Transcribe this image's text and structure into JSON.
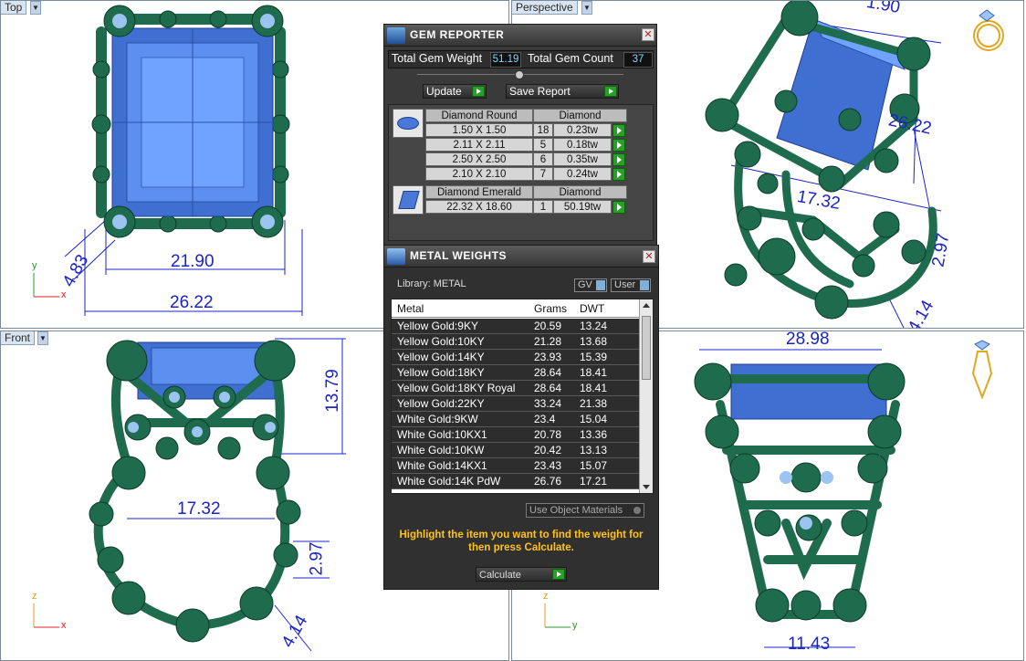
{
  "viewports": {
    "top": {
      "label": "Top"
    },
    "perspective": {
      "label": "Perspective"
    },
    "front": {
      "label": "Front"
    },
    "right": {
      "label": ""
    }
  },
  "dimensions": {
    "top": {
      "width": "21.90",
      "outer": "26.22",
      "side": "4.83"
    },
    "front": {
      "height": "13.79",
      "inner": "17.32",
      "small": "2.97",
      "band": "4.14"
    },
    "perspective": {
      "a": "1.90",
      "b": "26.22",
      "c": "17.32",
      "d": "2.97",
      "e": "4.14"
    },
    "right": {
      "width": "28.98",
      "bottom": "11.43"
    }
  },
  "axes": {
    "top": [
      "y",
      "x"
    ],
    "front": [
      "z",
      "x"
    ],
    "right": [
      "z",
      "y"
    ]
  },
  "gem_reporter": {
    "title": "GEM REPORTER",
    "total_weight_label": "Total Gem Weight",
    "total_weight_value": "51.19",
    "total_count_label": "Total Gem Count",
    "total_count_value": "37",
    "update_label": "Update",
    "save_label": "Save Report",
    "groups": [
      {
        "icon": "round-diamond-icon",
        "header": [
          "Diamond Round",
          "Diamond"
        ],
        "rows": [
          {
            "size": "1.50 X 1.50",
            "count": "18",
            "weight": "0.23tw"
          },
          {
            "size": "2.11 X 2.11",
            "count": "5",
            "weight": "0.18tw"
          },
          {
            "size": "2.50 X 2.50",
            "count": "6",
            "weight": "0.35tw"
          },
          {
            "size": "2.10 X 2.10",
            "count": "7",
            "weight": "0.24tw"
          }
        ]
      },
      {
        "icon": "emerald-diamond-icon",
        "header": [
          "Diamond Emerald",
          "Diamond"
        ],
        "rows": [
          {
            "size": "22.32 X 18.60",
            "count": "1",
            "weight": "50.19tw"
          }
        ]
      }
    ]
  },
  "metal_weights": {
    "title": "METAL WEIGHTS",
    "library_label": "Library: METAL",
    "gv_label": "GV",
    "user_label": "User",
    "columns": [
      "Metal",
      "Grams",
      "DWT"
    ],
    "rows": [
      {
        "metal": "Yellow Gold:9KY",
        "grams": "20.59",
        "dwt": "13.24"
      },
      {
        "metal": "Yellow Gold:10KY",
        "grams": "21.28",
        "dwt": "13.68"
      },
      {
        "metal": "Yellow Gold:14KY",
        "grams": "23.93",
        "dwt": "15.39"
      },
      {
        "metal": "Yellow Gold:18KY",
        "grams": "28.64",
        "dwt": "18.41"
      },
      {
        "metal": "Yellow Gold:18KY Royal",
        "grams": "28.64",
        "dwt": "18.41"
      },
      {
        "metal": "Yellow Gold:22KY",
        "grams": "33.24",
        "dwt": "21.38"
      },
      {
        "metal": "White Gold:9KW",
        "grams": "23.4",
        "dwt": "15.04"
      },
      {
        "metal": "White Gold:10KX1",
        "grams": "20.78",
        "dwt": "13.36"
      },
      {
        "metal": "White Gold:10KW",
        "grams": "20.42",
        "dwt": "13.13"
      },
      {
        "metal": "White Gold:14KX1",
        "grams": "23.43",
        "dwt": "15.07"
      },
      {
        "metal": "White Gold:14K PdW",
        "grams": "26.76",
        "dwt": "17.21"
      }
    ],
    "use_object_materials": "Use Object Materials",
    "hint": "Highlight the item you want to find the weight for then press Calculate.",
    "calculate_label": "Calculate"
  },
  "colors": {
    "gem": "#4a78d8",
    "metal": "#1f6b4e",
    "dimension": "#1a24c8",
    "panel": "#3a3a3a",
    "hint": "#ffc21a",
    "go": "#28a028"
  }
}
